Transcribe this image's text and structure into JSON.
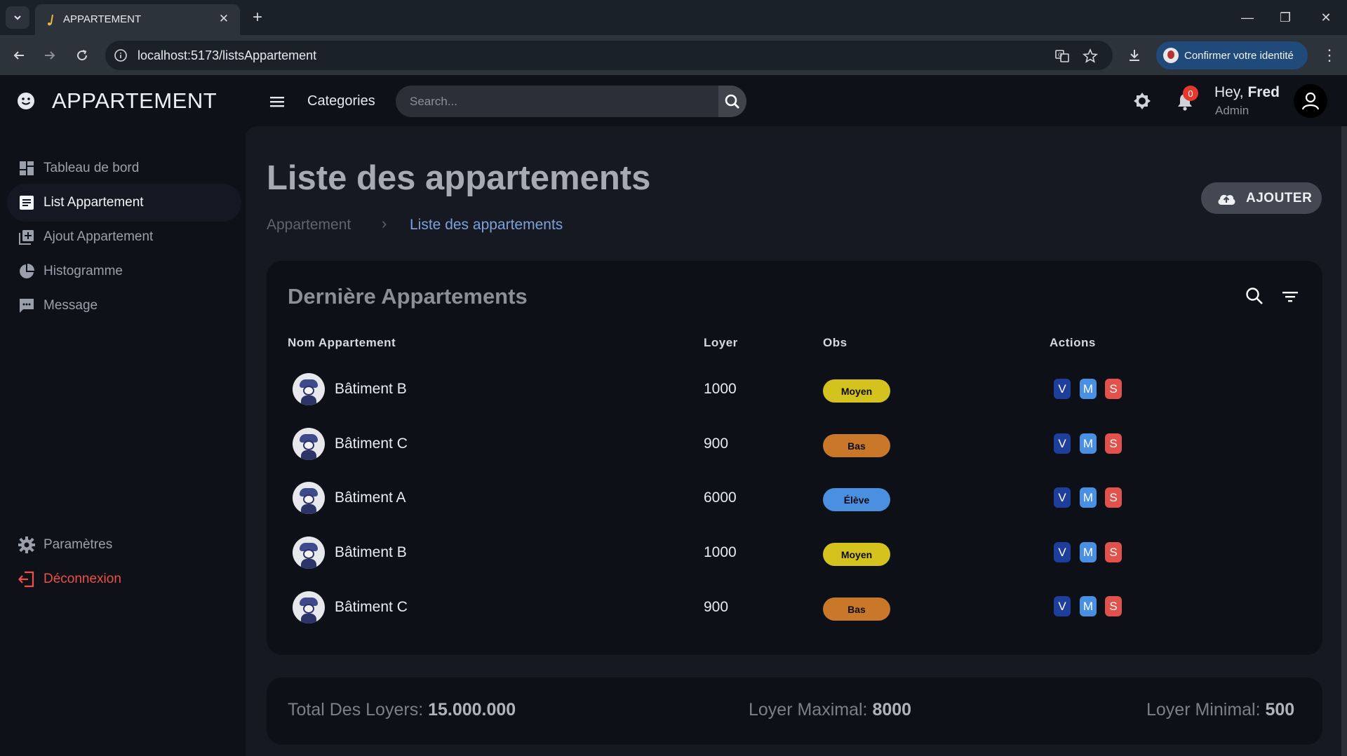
{
  "browser": {
    "tab_title": "APPARTEMENT",
    "url": "localhost:5173/listsAppartement",
    "identity_label": "Confirmer votre identité"
  },
  "brand": {
    "name": "APPARTEMENT"
  },
  "sidebar": {
    "items": [
      {
        "label": "Tableau de bord",
        "icon": "dashboard-icon",
        "active": false
      },
      {
        "label": "List Appartement",
        "icon": "list-icon",
        "active": true
      },
      {
        "label": "Ajout Appartement",
        "icon": "add-box-icon",
        "active": false
      },
      {
        "label": "Histogramme",
        "icon": "pie-chart-icon",
        "active": false
      },
      {
        "label": "Message",
        "icon": "message-icon",
        "active": false
      }
    ],
    "settings_label": "Paramètres",
    "logout_label": "Déconnexion"
  },
  "header": {
    "categories_label": "Categories",
    "search_placeholder": "Search...",
    "notification_count": "0",
    "greeting": "Hey, ",
    "user_name": "Fred",
    "user_role": "Admin"
  },
  "page": {
    "title": "Liste des appartements",
    "breadcrumb": [
      "Appartement",
      "Liste des appartements"
    ],
    "add_button_label": "AJOUTER"
  },
  "table": {
    "title": "Dernière Appartements",
    "columns": [
      "Nom Appartement",
      "Loyer",
      "Obs",
      "Actions"
    ],
    "rows": [
      {
        "name": "Bâtiment B",
        "loyer": "1000",
        "obs": "Moyen"
      },
      {
        "name": "Bâtiment C",
        "loyer": "900",
        "obs": "Bas"
      },
      {
        "name": "Bâtiment A",
        "loyer": "6000",
        "obs": "Élève"
      },
      {
        "name": "Bâtiment B",
        "loyer": "1000",
        "obs": "Moyen"
      },
      {
        "name": "Bâtiment C",
        "loyer": "900",
        "obs": "Bas"
      }
    ],
    "actions": [
      "V",
      "M",
      "S"
    ],
    "obs_colors": {
      "Moyen": "#d4c21f",
      "Bas": "#c9782a",
      "Élève": "#4a8fe0"
    },
    "action_colors": {
      "V": "#1d3e9b",
      "M": "#4a90e2",
      "S": "#e0524b"
    }
  },
  "stats": {
    "total_label": "Total Des Loyers: ",
    "total_value": "15.000.000",
    "max_label": "Loyer Maximal: ",
    "max_value": "8000",
    "min_label": "Loyer Minimal: ",
    "min_value": "500"
  }
}
